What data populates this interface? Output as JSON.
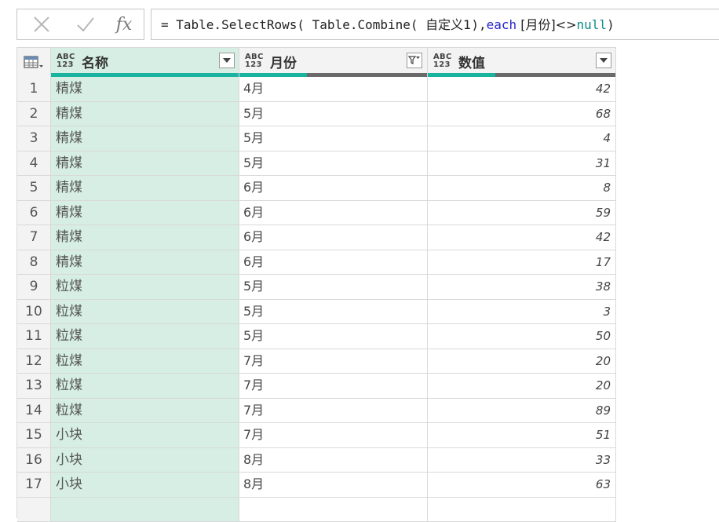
{
  "formula_bar": {
    "cancel_icon": "close-icon",
    "commit_icon": "check-icon",
    "fx_label": "fx",
    "prefix": "= Table.SelectRows( Table.Combine( ",
    "source_name": "自定义1",
    "mid": "),",
    "keyword_each": "each",
    "column_ref": " [月份]<>",
    "null_literal": "null",
    "suffix": ")"
  },
  "columns": [
    {
      "type_top": "ABC",
      "type_bottom": "123",
      "name": "名称",
      "quality_valid_fraction": 1.0,
      "filtered": false
    },
    {
      "type_top": "ABC",
      "type_bottom": "123",
      "name": "月份",
      "quality_valid_fraction": 0.36,
      "filtered": true
    },
    {
      "type_top": "ABC",
      "type_bottom": "123",
      "name": "数值",
      "quality_valid_fraction": 0.36,
      "filtered": false
    }
  ],
  "colors": {
    "accent_quality": "#1ab3a0",
    "selected_column": "#d6eee3",
    "keyword": "#2929c9",
    "null_literal": "#0d8a8a"
  },
  "rows": [
    {
      "n": "1",
      "name": "精煤",
      "month": "4月",
      "value": "42"
    },
    {
      "n": "2",
      "name": "精煤",
      "month": "5月",
      "value": "68"
    },
    {
      "n": "3",
      "name": "精煤",
      "month": "5月",
      "value": "4"
    },
    {
      "n": "4",
      "name": "精煤",
      "month": "5月",
      "value": "31"
    },
    {
      "n": "5",
      "name": "精煤",
      "month": "6月",
      "value": "8"
    },
    {
      "n": "6",
      "name": "精煤",
      "month": "6月",
      "value": "59"
    },
    {
      "n": "7",
      "name": "精煤",
      "month": "6月",
      "value": "42"
    },
    {
      "n": "8",
      "name": "精煤",
      "month": "6月",
      "value": "17"
    },
    {
      "n": "9",
      "name": "粒煤",
      "month": "5月",
      "value": "38"
    },
    {
      "n": "10",
      "name": "粒煤",
      "month": "5月",
      "value": "3"
    },
    {
      "n": "11",
      "name": "粒煤",
      "month": "5月",
      "value": "50"
    },
    {
      "n": "12",
      "name": "粒煤",
      "month": "7月",
      "value": "20"
    },
    {
      "n": "13",
      "name": "粒煤",
      "month": "7月",
      "value": "20"
    },
    {
      "n": "14",
      "name": "粒煤",
      "month": "7月",
      "value": "89"
    },
    {
      "n": "15",
      "name": "小块",
      "month": "7月",
      "value": "51"
    },
    {
      "n": "16",
      "name": "小块",
      "month": "8月",
      "value": "33"
    },
    {
      "n": "17",
      "name": "小块",
      "month": "8月",
      "value": "63"
    },
    {
      "n": "",
      "name": "",
      "month": "",
      "value": ""
    }
  ]
}
